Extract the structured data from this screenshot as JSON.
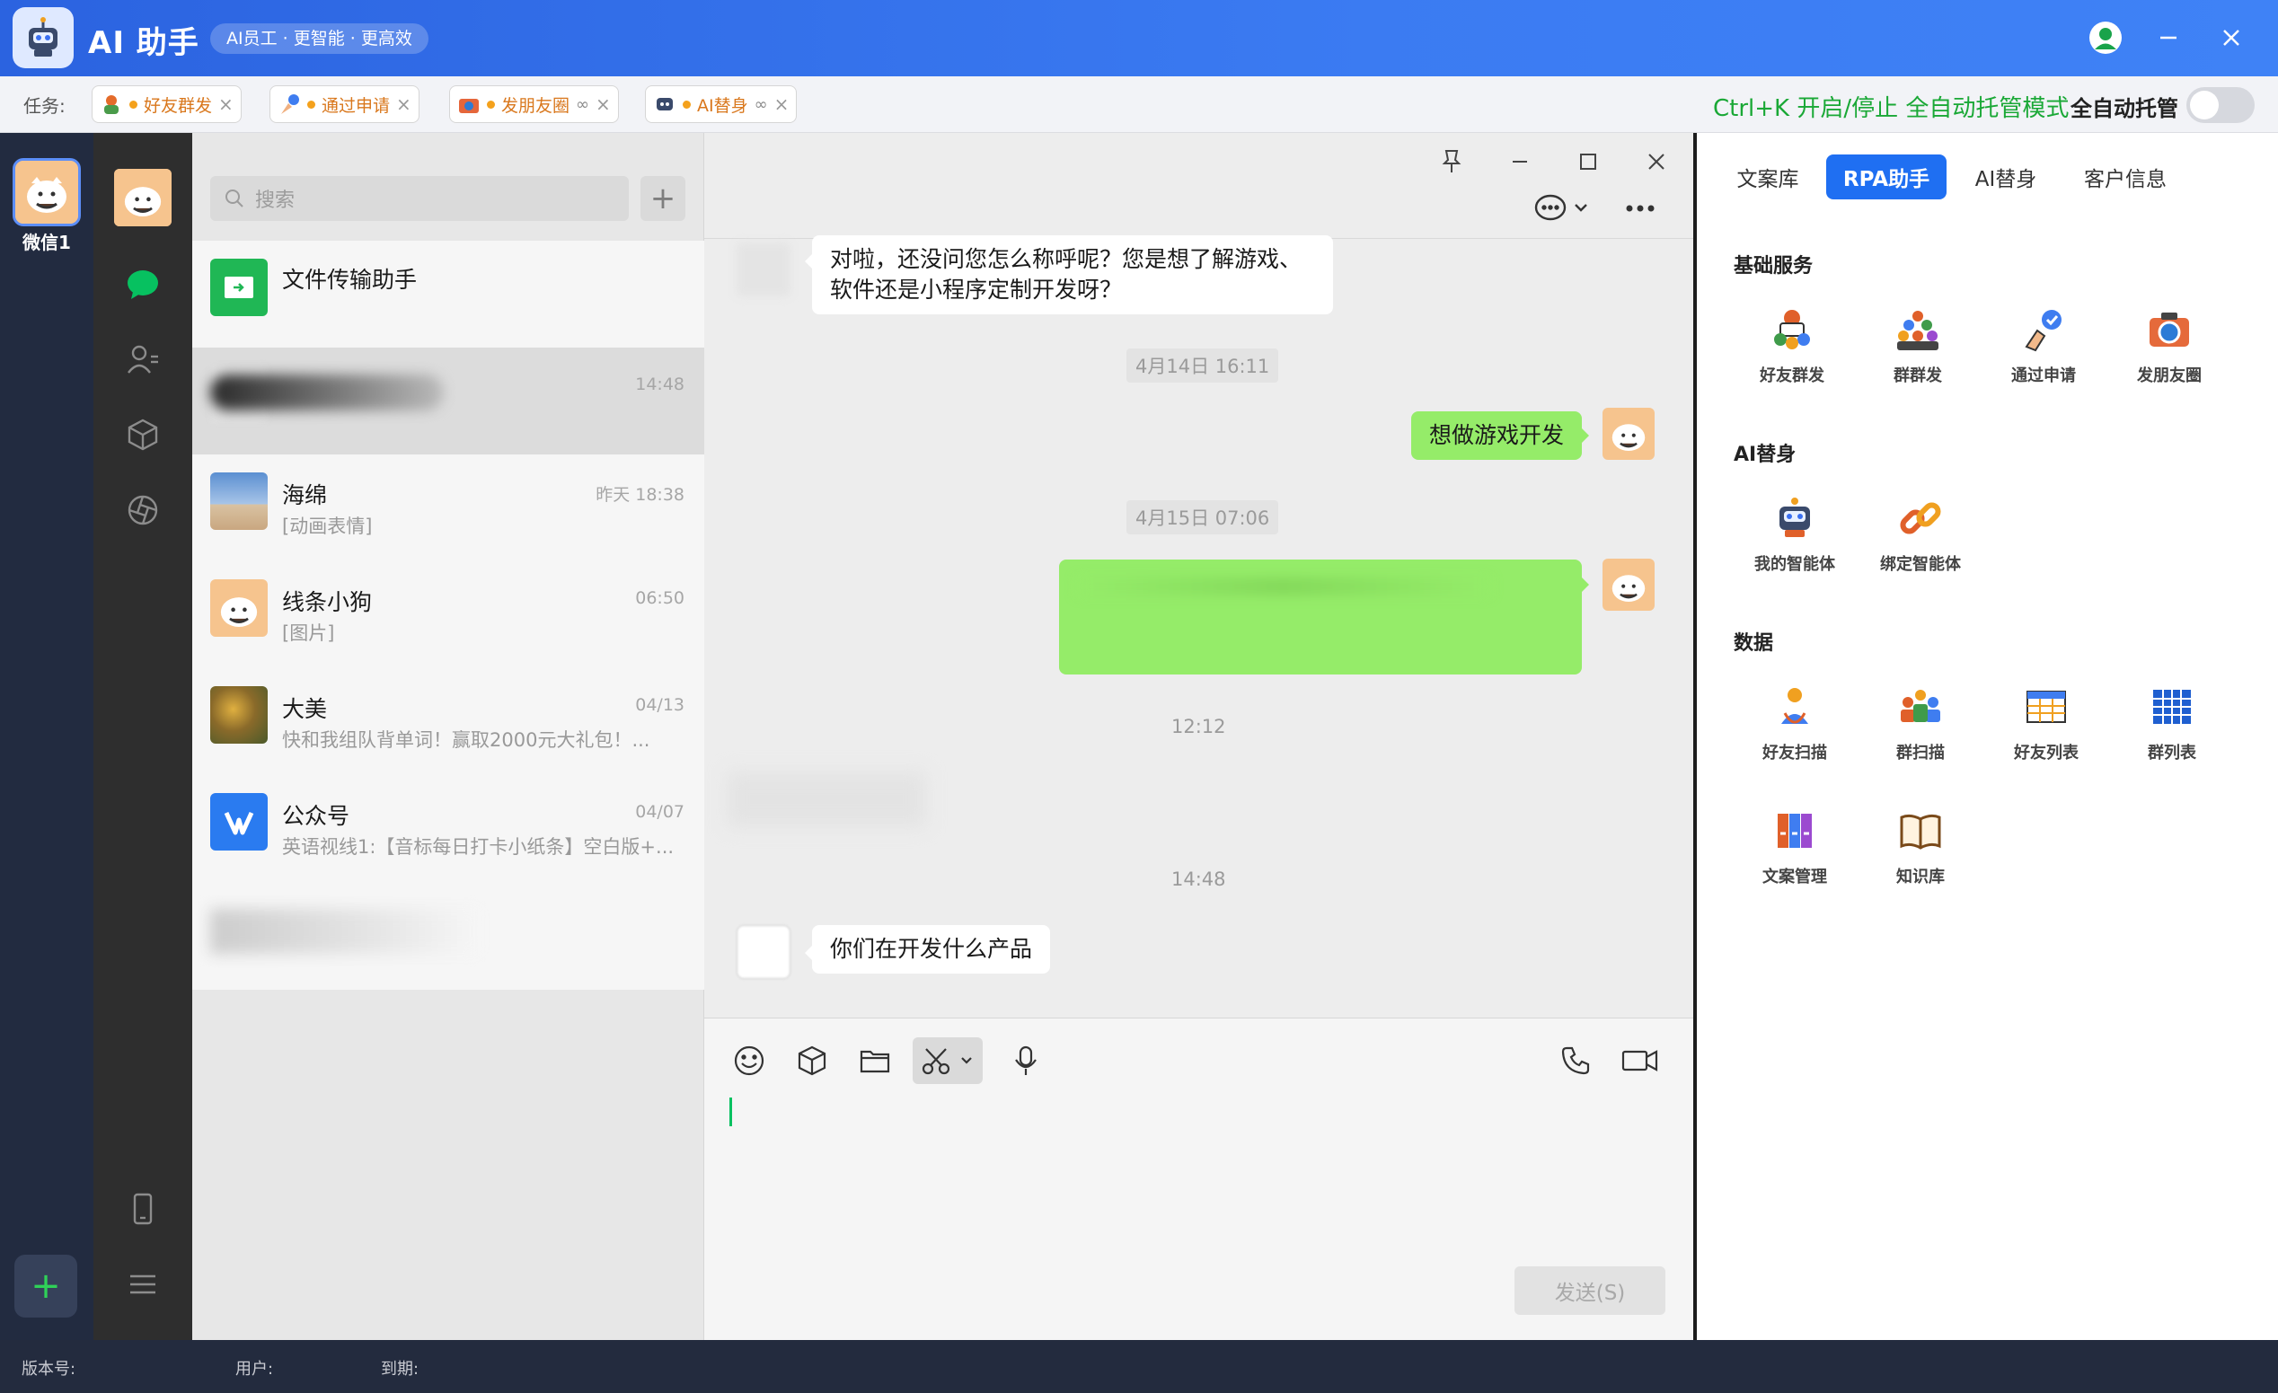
{
  "app": {
    "title": "AI 助手",
    "slogan": "AI员工 · 更智能 · 更高效"
  },
  "tasks": {
    "label": "任务:",
    "chips": [
      {
        "name": "好友群发",
        "infinite": ""
      },
      {
        "name": "通过申请",
        "infinite": ""
      },
      {
        "name": "发朋友圈",
        "infinite": "∞"
      },
      {
        "name": "AI替身",
        "infinite": "∞"
      }
    ],
    "hotkey": "Ctrl+K 开启/停止 全自动托管模式",
    "auto_label": "全自动托管"
  },
  "account": {
    "label": "微信1",
    "add": "+"
  },
  "chatlist": {
    "search_placeholder": "搜索",
    "items": [
      {
        "name": "文件传输助手",
        "time": "",
        "msg": ""
      },
      {
        "name": "",
        "time": "14:48",
        "msg": ""
      },
      {
        "name": "海绵",
        "time": "昨天 18:38",
        "msg": "[动画表情]"
      },
      {
        "name": "线条小狗",
        "time": "06:50",
        "msg": "[图片]"
      },
      {
        "name": "大美",
        "time": "04/13",
        "msg": "快和我组队背单词！赢取2000元大礼包！..."
      },
      {
        "name": "公众号",
        "time": "04/07",
        "msg": "英语视线1:【音标每日打卡小纸条】空白版+..."
      }
    ]
  },
  "chat": {
    "msg1": "对啦，还没问您怎么称呼呢？您是想了解游戏、软件还是小程序定制开发呀？",
    "ts1": "4月14日 16:11",
    "msg2": "想做游戏开发",
    "ts2": "4月15日 07:06",
    "ts3": "12:12",
    "ts4": "14:48",
    "msg5": "你们在开发什么产品",
    "send": "发送(S)"
  },
  "panel": {
    "tabs": [
      "文案库",
      "RPA助手",
      "AI替身",
      "客户信息"
    ],
    "basic_title": "基础服务",
    "basic": [
      "好友群发",
      "群群发",
      "通过申请",
      "发朋友圈"
    ],
    "ai_title": "AI替身",
    "ai": [
      "我的智能体",
      "绑定智能体"
    ],
    "data_title": "数据",
    "data": [
      "好友扫描",
      "群扫描",
      "好友列表",
      "群列表",
      "文案管理",
      "知识库"
    ]
  },
  "status": {
    "version": "版本号:",
    "user": "用户:",
    "expire": "到期:"
  },
  "colors": {
    "brand_blue": "#2b63e0",
    "wechat_green": "#95ec69",
    "hotkey_green": "#1aa836",
    "task_orange": "#d9771c"
  },
  "icons": [
    "robot-icon",
    "user-avatar-icon",
    "minimize-icon",
    "close-icon",
    "folder-arrow-icon",
    "chat-bubble-icon",
    "contacts-icon",
    "cube-icon",
    "aperture-icon",
    "phone-icon",
    "menu-icon",
    "pin-icon",
    "maximize-icon",
    "more-icon",
    "emoji-icon",
    "scissors-icon",
    "mic-icon",
    "call-icon",
    "video-icon"
  ]
}
